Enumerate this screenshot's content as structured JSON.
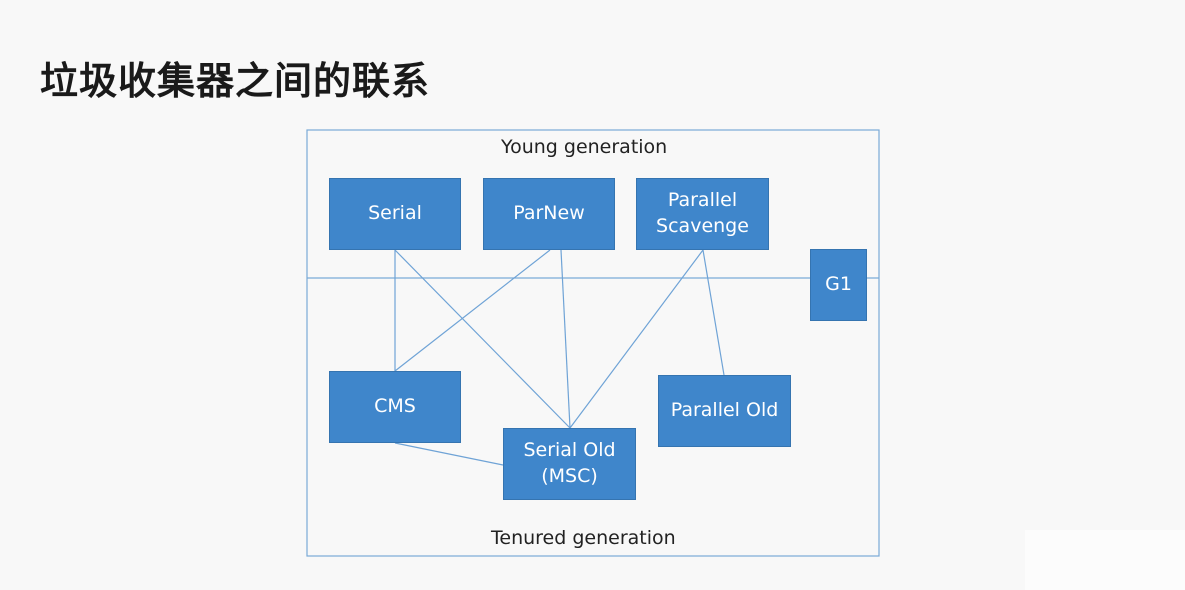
{
  "title": "垃圾收集器之间的联系",
  "diagram": {
    "young_label": "Young generation",
    "tenured_label": "Tenured generation",
    "nodes": {
      "serial": "Serial",
      "parnew": "ParNew",
      "parallel_scavenge": "Parallel\nScavenge",
      "g1": "G1",
      "cms": "CMS",
      "serial_old": "Serial Old\n(MSC)",
      "parallel_old": "Parallel Old"
    },
    "edges": [
      [
        "serial",
        "cms"
      ],
      [
        "serial",
        "serial_old"
      ],
      [
        "parnew",
        "cms"
      ],
      [
        "parnew",
        "serial_old"
      ],
      [
        "parallel_scavenge",
        "serial_old"
      ],
      [
        "parallel_scavenge",
        "parallel_old"
      ],
      [
        "cms",
        "serial_old"
      ]
    ],
    "colors": {
      "node_fill": "#3f86cb",
      "line": "#6fa3d6"
    }
  }
}
